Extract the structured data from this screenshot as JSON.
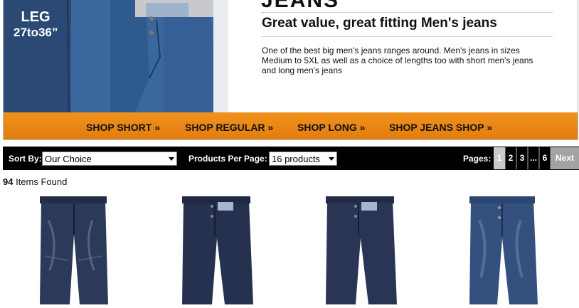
{
  "banner": {
    "hero_leg_label": "LEG",
    "hero_leg_range": "27to36”",
    "headline_partial": "JEANS",
    "subtitle": "Great value, great fitting Men's jeans",
    "description": "One of the best big men's jeans ranges around. Men's jeans in sizes Medium to 5XL as well as a choice of lengths too with short men's jeans and long men's jeans"
  },
  "shop_links": [
    {
      "label": "SHOP SHORT »"
    },
    {
      "label": "SHOP REGULAR »"
    },
    {
      "label": "SHOP LONG »"
    },
    {
      "label": "SHOP JEANS SHOP »"
    }
  ],
  "toolbar": {
    "sort_label": "Sort By:",
    "sort_value": "Our Choice",
    "per_page_label": "Products Per Page:",
    "per_page_value": "16 products",
    "pages_label": "Pages:",
    "pages": [
      "1",
      "2",
      "3",
      "...",
      "6"
    ],
    "current_page": "1",
    "next_label": "Next"
  },
  "results": {
    "count": "94",
    "suffix": " Items Found"
  },
  "products": [
    {
      "name": "jeans-dark-vintage-wash",
      "wash_color": "#2b3a5a"
    },
    {
      "name": "jeans-dark-indigo",
      "wash_color": "#26314f"
    },
    {
      "name": "jeans-indigo",
      "wash_color": "#2a3556"
    },
    {
      "name": "jeans-mid-blue",
      "wash_color": "#34507e"
    }
  ],
  "colors": {
    "accent_orange": "#e9871a",
    "toolbar_black": "#000000"
  }
}
